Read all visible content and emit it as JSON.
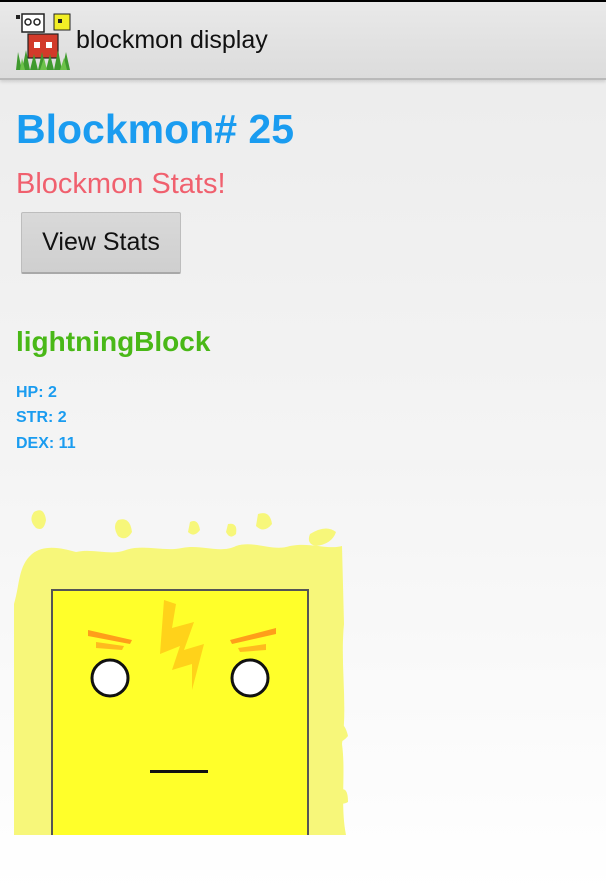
{
  "app": {
    "title": "blockmon display",
    "icon": "blockmon-app-icon"
  },
  "main": {
    "heading": "Blockmon# 25",
    "subheading": "Blockmon Stats!",
    "view_button_label": "View Stats",
    "blockmon": {
      "name": "lightningBlock",
      "stats": {
        "hp": "HP: 2",
        "str": "STR: 2",
        "dex": "DEX: 11"
      },
      "image": "lightning-block-creature"
    }
  },
  "colors": {
    "heading": "#1a9cf0",
    "subheading": "#f0606e",
    "name": "#49b817",
    "stats": "#1a9cf0",
    "block_yellow": "#ffff2a",
    "aura_yellow": "#f7f77a",
    "bolt": "#ffd21a"
  }
}
